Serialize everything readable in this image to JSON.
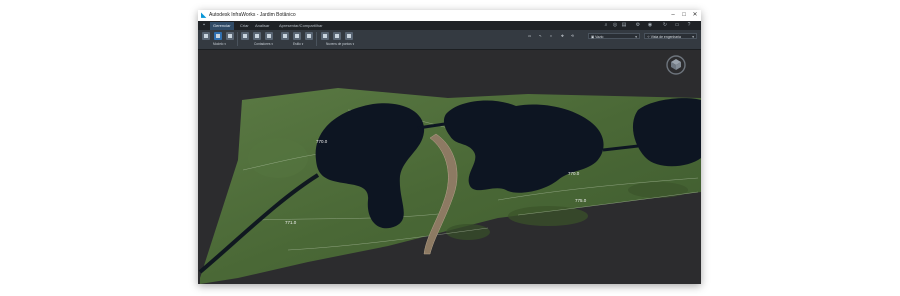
{
  "window": {
    "title": "Autodesk InfraWorks - Jardim Botânico",
    "minimize": "–",
    "maximize": "□",
    "close": "✕"
  },
  "menu": {
    "tabs": [
      {
        "label": "Gerenciar"
      },
      {
        "label": "Criar"
      },
      {
        "label": "Analisar"
      },
      {
        "label": "Apresentar/Compartilhar"
      }
    ],
    "active_index": 0
  },
  "ribbon": {
    "groups": [
      {
        "label": "Modelo"
      },
      {
        "label": "Contadores"
      },
      {
        "label": "Estilo"
      },
      {
        "label": "Nuvens de pontos"
      }
    ],
    "view_mode": "Vazio",
    "camera": "Vista de engenharia"
  },
  "map": {
    "contour_labels": [
      "770.0",
      "770.0",
      "775.0",
      "771.0"
    ]
  },
  "colors": {
    "app_bg": "#2a2d31",
    "accent": "#2f6fb0",
    "water": "#0d1522",
    "terrain": "#4d6b38"
  }
}
